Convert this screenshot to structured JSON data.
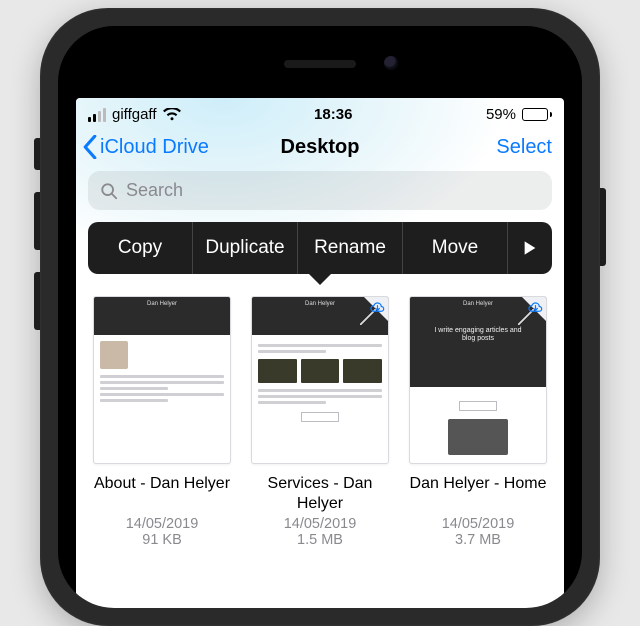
{
  "status": {
    "carrier": "giffgaff",
    "time": "18:36",
    "battery_pct": "59%"
  },
  "nav": {
    "back_label": "iCloud Drive",
    "title": "Desktop",
    "select_label": "Select"
  },
  "search": {
    "placeholder": "Search"
  },
  "context_menu": {
    "copy": "Copy",
    "duplicate": "Duplicate",
    "rename": "Rename",
    "move": "Move"
  },
  "files": [
    {
      "name": "About - Dan Helyer",
      "date": "14/05/2019",
      "size": "91 KB",
      "cloud": false
    },
    {
      "name": "Services - Dan Helyer",
      "date": "14/05/2019",
      "size": "1.5 MB",
      "cloud": true
    },
    {
      "name": "Dan Helyer - Home",
      "date": "14/05/2019",
      "size": "3.7 MB",
      "cloud": true
    }
  ]
}
